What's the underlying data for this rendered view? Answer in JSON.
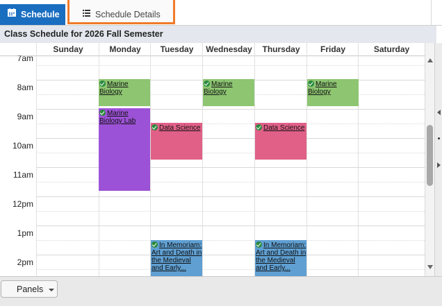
{
  "tabs": {
    "schedule_label": "Schedule",
    "details_label": "Schedule Details"
  },
  "title": "Class Schedule for 2026 Fall Semester",
  "days": [
    "Sunday",
    "Monday",
    "Tuesday",
    "Wednesday",
    "Thursday",
    "Friday",
    "Saturday"
  ],
  "times": [
    "7am",
    "8am",
    "9am",
    "10am",
    "11am",
    "12pm",
    "1pm",
    "2pm"
  ],
  "events": [
    {
      "title": "Marine Biology",
      "day": "Monday",
      "start": "8:00am",
      "end": "9:00am",
      "color": "#8dc571",
      "status": "confirmed"
    },
    {
      "title": "Marine Biology",
      "day": "Wednesday",
      "start": "8:00am",
      "end": "9:00am",
      "color": "#8dc571",
      "status": "confirmed"
    },
    {
      "title": "Marine Biology",
      "day": "Friday",
      "start": "8:00am",
      "end": "9:00am",
      "color": "#8dc571",
      "status": "confirmed"
    },
    {
      "title": "Marine Biology Lab",
      "day": "Monday",
      "start": "9:00am",
      "end": "11:50am",
      "color": "#9c52d6",
      "status": "confirmed"
    },
    {
      "title": "Data Science",
      "day": "Tuesday",
      "start": "9:30am",
      "end": "10:45am",
      "color": "#e06088",
      "status": "confirmed"
    },
    {
      "title": "Data Science",
      "day": "Thursday",
      "start": "9:30am",
      "end": "10:45am",
      "color": "#e06088",
      "status": "confirmed"
    },
    {
      "title": "In Memoriam: Art and Death in the Medieval and Early...",
      "day": "Tuesday",
      "start": "1:30pm",
      "end": "",
      "color": "#5f9fd2",
      "status": "confirmed"
    },
    {
      "title": "In Memoriam: Art and Death in the Medieval and Early...",
      "day": "Thursday",
      "start": "1:30pm",
      "end": "",
      "color": "#5f9fd2",
      "status": "confirmed"
    }
  ],
  "bottom": {
    "panels_label": "Panels"
  },
  "icons": {
    "schedule_tab": "calendar-icon",
    "details_tab": "list-icon",
    "event_status": "check-circle-icon",
    "panels_menu": "caret-down-icon"
  }
}
